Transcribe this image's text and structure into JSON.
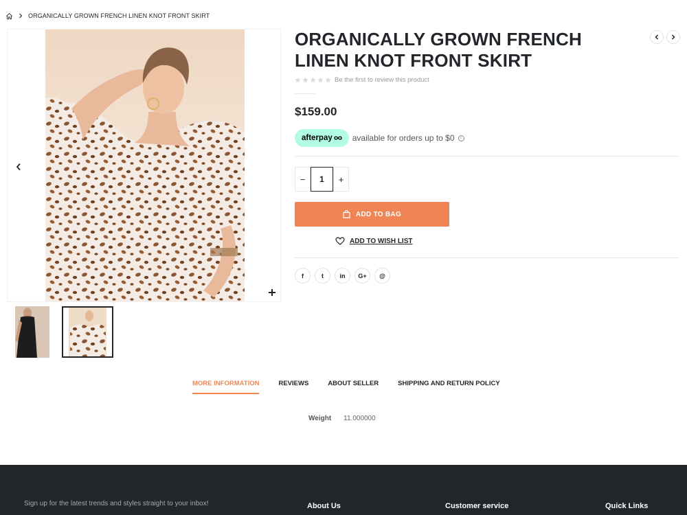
{
  "breadcrumb": {
    "home_icon": "home-icon",
    "separator_icon": "chevron-right-icon",
    "current": "ORGANICALLY GROWN FRENCH LINEN KNOT FRONT SKIRT"
  },
  "product": {
    "title": "ORGANICALLY GROWN FRENCH LINEN KNOT FRONT SKIRT",
    "review_prompt": "Be the first to review this product",
    "price": "$159.00",
    "afterpay_brand": "afterpay",
    "afterpay_text": "available for orders up to $0",
    "afterpay_info": "i",
    "quantity": "1",
    "qty_minus": "−",
    "qty_plus": "+",
    "add_to_bag": "ADD TO BAG",
    "wishlist": "ADD TO WISH LIST"
  },
  "share": [
    "f",
    "t",
    "in",
    "G+",
    "@"
  ],
  "tabs": [
    "MORE INFORMATION",
    "REVIEWS",
    "ABOUT SELLER",
    "SHIPPING AND RETURN POLICY"
  ],
  "attributes": {
    "label": "Weight",
    "value": "11.000000"
  },
  "footer": {
    "signup": "Sign up for the latest trends and styles straight to your inbox!",
    "col1": "About Us",
    "col2": "Customer service",
    "col3": "Quick Links"
  },
  "colors": {
    "accent": "#f08454",
    "dark": "#222529",
    "afterpay": "#b2fce4"
  }
}
